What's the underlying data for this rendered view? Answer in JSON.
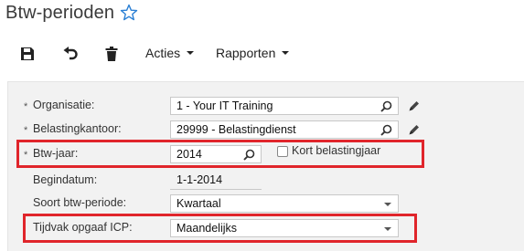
{
  "header": {
    "title": "Btw-perioden",
    "favorite_icon": "star-outline-icon"
  },
  "toolbar": {
    "save_icon": "save-icon",
    "undo_icon": "undo-icon",
    "delete_icon": "trash-icon",
    "actions_label": "Acties",
    "reports_label": "Rapporten"
  },
  "form": {
    "required_marker": "*",
    "organisation": {
      "label": "Organisatie:",
      "value": "1 - Your IT Training"
    },
    "tax_office": {
      "label": "Belastingkantoor:",
      "value": "29999 - Belastingdienst"
    },
    "vat_year": {
      "label": "Btw-jaar:",
      "value": "2014"
    },
    "short_tax_year": {
      "label": "Kort belastingjaar",
      "checked": false
    },
    "start_date": {
      "label": "Begindatum:",
      "value": "1-1-2014"
    },
    "vat_period_type": {
      "label": "Soort btw-periode:",
      "value": "Kwartaal"
    },
    "icp_period": {
      "label": "Tijdvak opgaaf ICP:",
      "value": "Maandelijks"
    }
  },
  "colors": {
    "highlight": "#e0252b",
    "accent": "#2a7fd4"
  }
}
